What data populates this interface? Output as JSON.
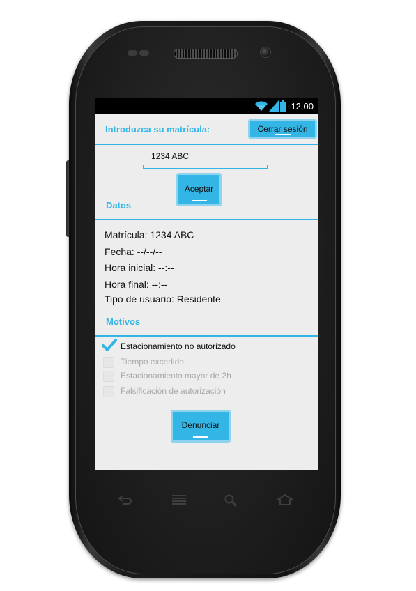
{
  "status_bar": {
    "time": "12:00",
    "icons": [
      "wifi-icon",
      "signal-icon",
      "battery-icon"
    ]
  },
  "header": {
    "plate_prompt": "Introduzca su matrícula:",
    "logout_label": "Cerrar sesión"
  },
  "plate_input": {
    "value": "1234 ABC"
  },
  "accept_label": "Aceptar",
  "datos": {
    "title": "Datos",
    "lines": [
      "Matrícula: 1234 ABC",
      "Fecha: --/--/--",
      "Hora inicial: --:--",
      "Hora final: --:--",
      "Tipo de usuario: Residente"
    ]
  },
  "motivos": {
    "title": "Motivos",
    "options": [
      {
        "label": "Estacionamiento no autorizado",
        "checked": true,
        "enabled": true
      },
      {
        "label": "Tiempo excedido",
        "checked": false,
        "enabled": false
      },
      {
        "label": "Estacionamiento mayor de 2h",
        "checked": false,
        "enabled": false
      },
      {
        "label": "Falsificación de autorización",
        "checked": false,
        "enabled": false
      }
    ]
  },
  "report_label": "Denunciar",
  "nav_keys": [
    "back-icon",
    "menu-icon",
    "search-icon",
    "home-icon"
  ],
  "colors": {
    "accent": "#33b5e5",
    "button_border": "#8fd3ef",
    "screen_bg": "#ededed",
    "status_bar": "#000000"
  }
}
